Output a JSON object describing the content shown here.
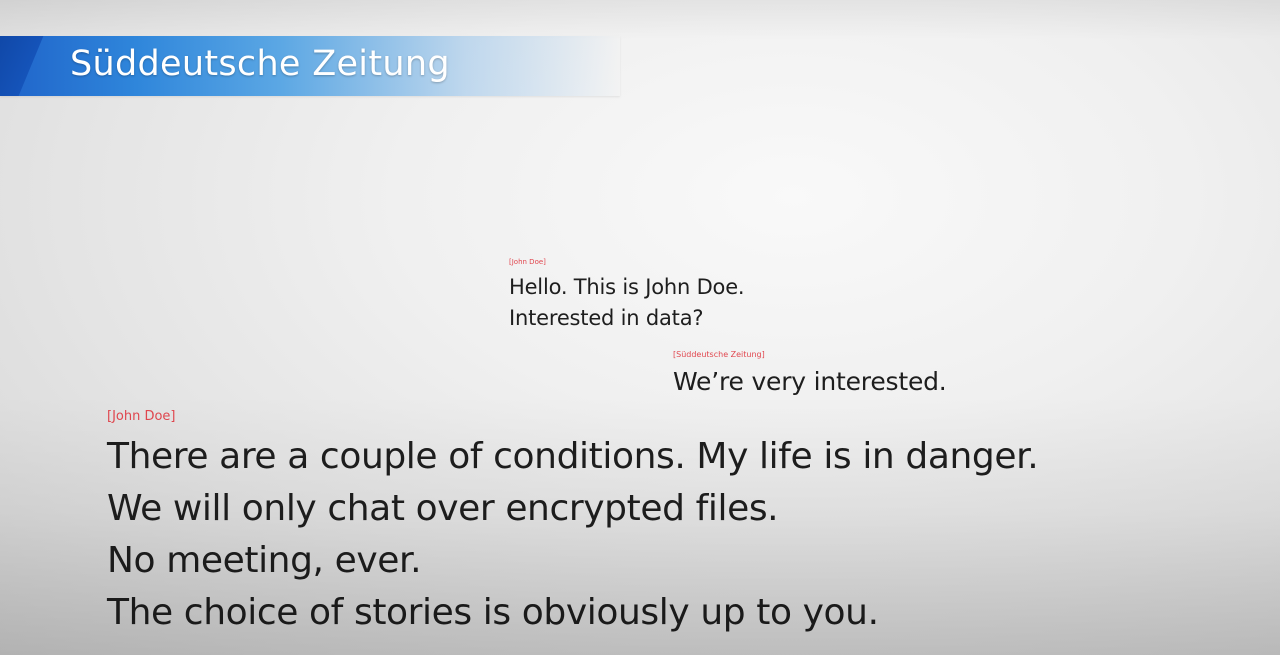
{
  "banner": {
    "title": "Süddeutsche Zeitung"
  },
  "colors": {
    "banner_blue": "#2f86db",
    "sender_red": "#e1474f",
    "text_dark": "#1e1e1e"
  },
  "messages": [
    {
      "sender": "[John Doe]",
      "lines": [
        "Hello. This is John Doe.",
        "Interested in data?"
      ]
    },
    {
      "sender": "[Süddeutsche Zeitung]",
      "lines": [
        "We’re very interested."
      ]
    },
    {
      "sender": "[John Doe]",
      "lines": [
        "There are a couple of conditions. My life is in danger.",
        "We will only chat over encrypted files.",
        "No meeting, ever.",
        "The choice of stories is obviously up to you."
      ]
    }
  ]
}
